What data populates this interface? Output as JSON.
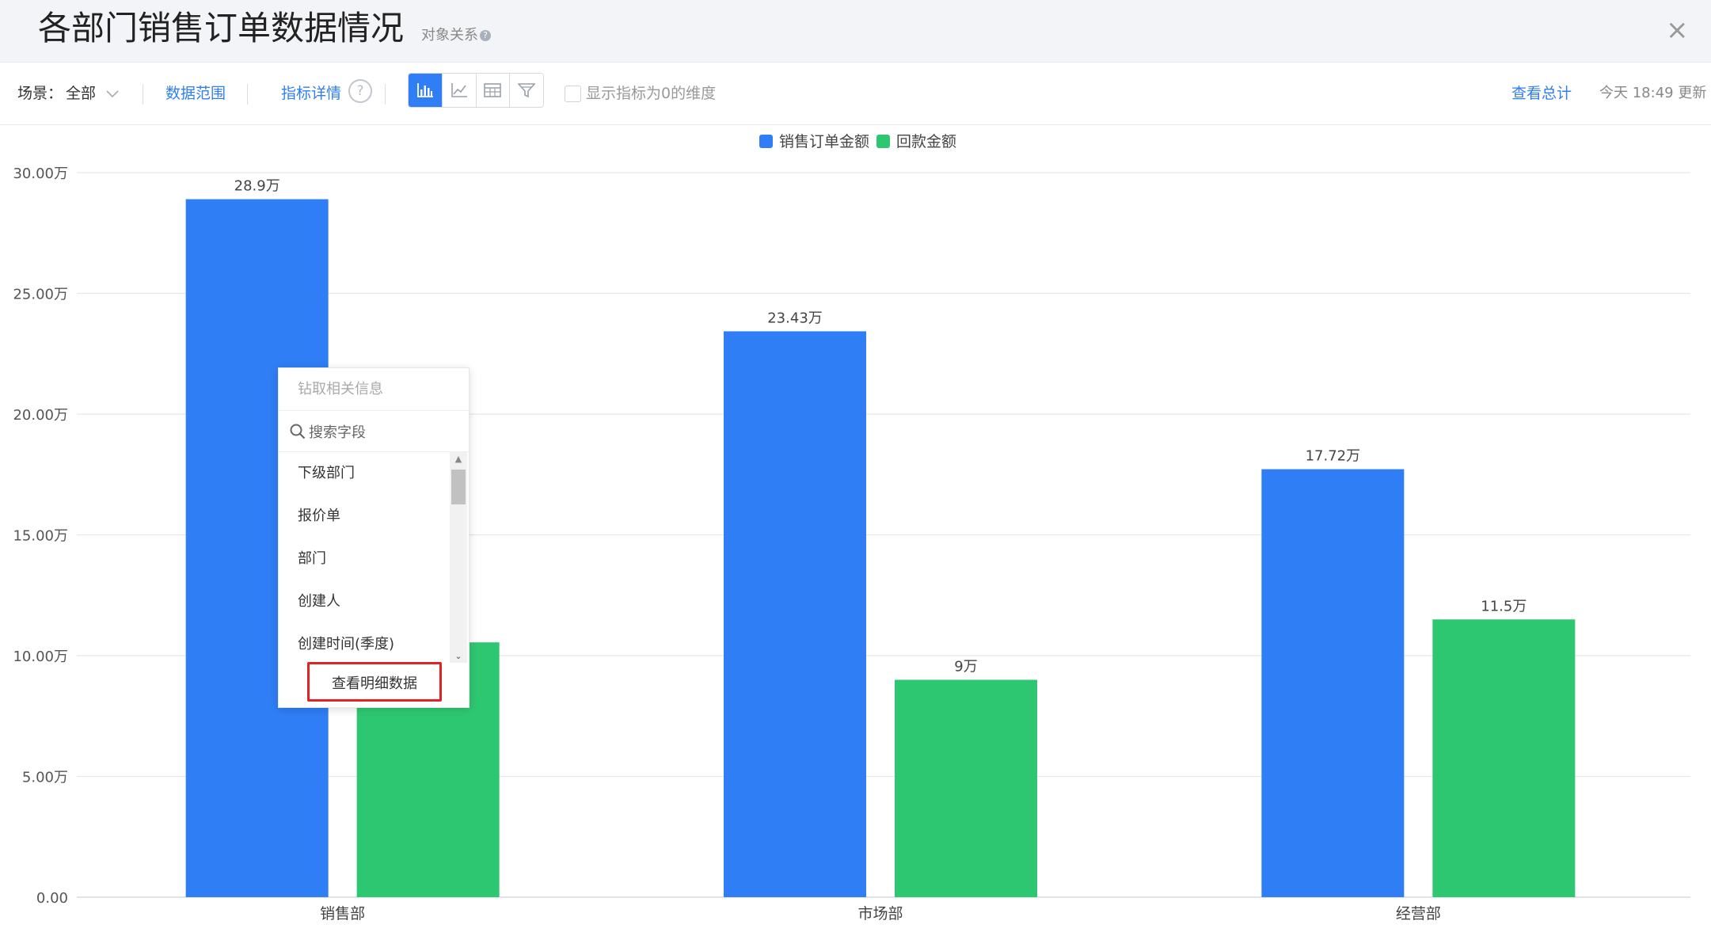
{
  "header": {
    "title": "各部门销售订单数据情况",
    "object_relation": "对象关系",
    "close_symbol": "×"
  },
  "toolbar": {
    "scene_label": "场景：",
    "scene_value": "全部",
    "data_range": "数据范围",
    "metric_detail": "指标详情",
    "show_zero_label": "显示指标为0的维度",
    "view_total": "查看总计",
    "updated": "今天 18:49 更新",
    "view_buttons": [
      "bar-chart-icon",
      "line-chart-icon",
      "table-icon",
      "funnel-icon"
    ],
    "active_view": "bar-chart-icon"
  },
  "menu": {
    "header": "钻取相关信息",
    "search_placeholder": "搜索字段",
    "items": [
      "下级部门",
      "报价单",
      "部门",
      "创建人",
      "创建时间(季度)"
    ],
    "detail_button": "查看明细数据"
  },
  "chart_data": {
    "type": "bar",
    "categories": [
      "销售部",
      "市场部",
      "经营部"
    ],
    "series": [
      {
        "name": "销售订单金额",
        "values": [
          28.9,
          23.43,
          17.72
        ],
        "labels": [
          "28.9万",
          "23.43万",
          "17.72万"
        ],
        "color": "#2f7ef5"
      },
      {
        "name": "回款金额",
        "values": [
          10.55,
          9,
          11.5
        ],
        "labels": [
          "10.55万",
          "9万",
          "11.5万"
        ],
        "color": "#2ec771"
      }
    ],
    "yticks": [
      "0.00",
      "5.00万",
      "10.00万",
      "15.00万",
      "20.00万",
      "25.00万",
      "30.00万"
    ],
    "ylim": [
      0,
      30
    ],
    "grid": true,
    "legend": "top-center"
  }
}
